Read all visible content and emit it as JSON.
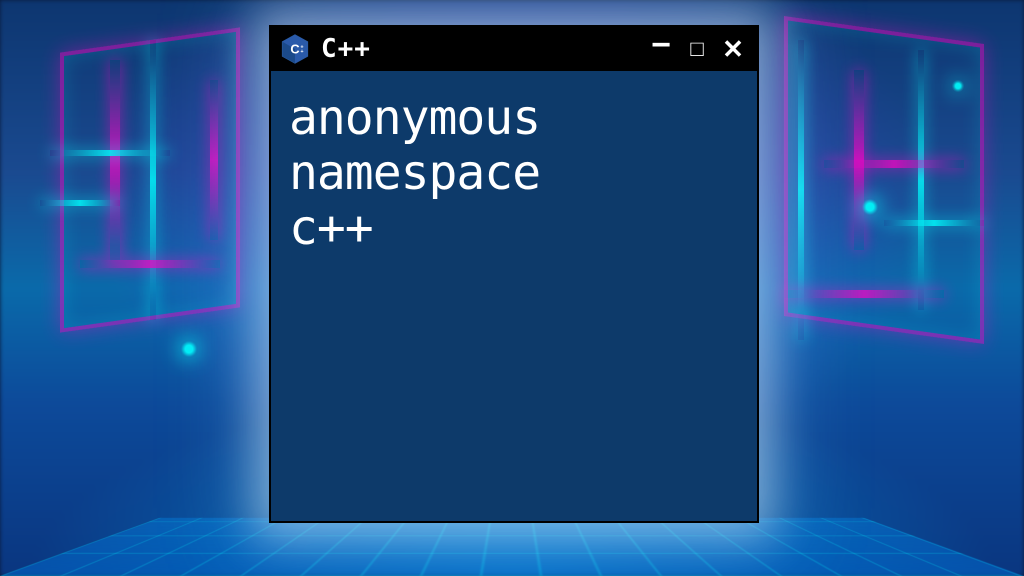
{
  "window": {
    "title": "C++",
    "content_line1": "anonymous",
    "content_line2": "namespace",
    "content_line3": "c++"
  },
  "icon": {
    "label": "C++"
  },
  "colors": {
    "content_bg": "#0d3a6a",
    "titlebar_bg": "#000000",
    "text": "#ffffff"
  }
}
